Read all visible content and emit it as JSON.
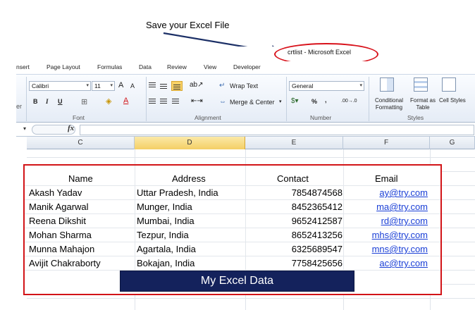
{
  "annotation": {
    "callout_text": "Save your Excel File"
  },
  "window": {
    "title": "crtlist  -  Microsoft Excel"
  },
  "tabs": [
    "nsert",
    "Page Layout",
    "Formulas",
    "Data",
    "Review",
    "View",
    "Developer"
  ],
  "ribbon": {
    "font_name": "Calibri",
    "font_size": "11",
    "grow_font": "A",
    "shrink_font": "A",
    "bold": "B",
    "italic": "I",
    "underline": "U",
    "clipboard_partial": "er",
    "wrap_text": "Wrap Text",
    "merge_center": "Merge & Center",
    "number_format": "General",
    "percent": "%",
    "comma": ",",
    "inc_decimal": ".00→.0",
    "conditional_formatting": "Conditional Formatting",
    "format_as_table": "Format as Table",
    "cell_styles": "Cell Styles",
    "groups": {
      "font": "Font",
      "alignment": "Alignment",
      "number": "Number",
      "styles": "Styles"
    }
  },
  "formula_bar": {
    "fx": "fx",
    "value": ""
  },
  "columns": [
    "C",
    "D",
    "E",
    "F",
    "G"
  ],
  "active_column": "D",
  "table": {
    "headers": {
      "name": "Name",
      "address": "Address",
      "contact": "Contact",
      "email": "Email"
    },
    "rows": [
      {
        "name": "Akash Yadav",
        "address": "Uttar Pradesh, India",
        "contact": "7854874568",
        "email": "ay@try.com"
      },
      {
        "name": "Manik Agarwal",
        "address": "Munger, India",
        "contact": "8452365412",
        "email": "ma@try.com"
      },
      {
        "name": "Reena Dikshit",
        "address": "Mumbai, India",
        "contact": "9652412587",
        "email": "rd@try.com"
      },
      {
        "name": "Mohan Sharma",
        "address": "Tezpur, India",
        "contact": "8652413256",
        "email": "mhs@try.com"
      },
      {
        "name": "Munna Mahajon",
        "address": "Agartala, India",
        "contact": "6325689547",
        "email": "mns@try.com"
      },
      {
        "name": "Avijit Chakraborty",
        "address": "Bokajan, India",
        "contact": "7758425656",
        "email": "ac@try.com"
      }
    ]
  },
  "banner_text": "My Excel Data",
  "colors": {
    "highlight_red": "#d21418",
    "banner_navy": "#14225c",
    "link_blue": "#1a3fd6",
    "active_column": "#f4cf65"
  }
}
